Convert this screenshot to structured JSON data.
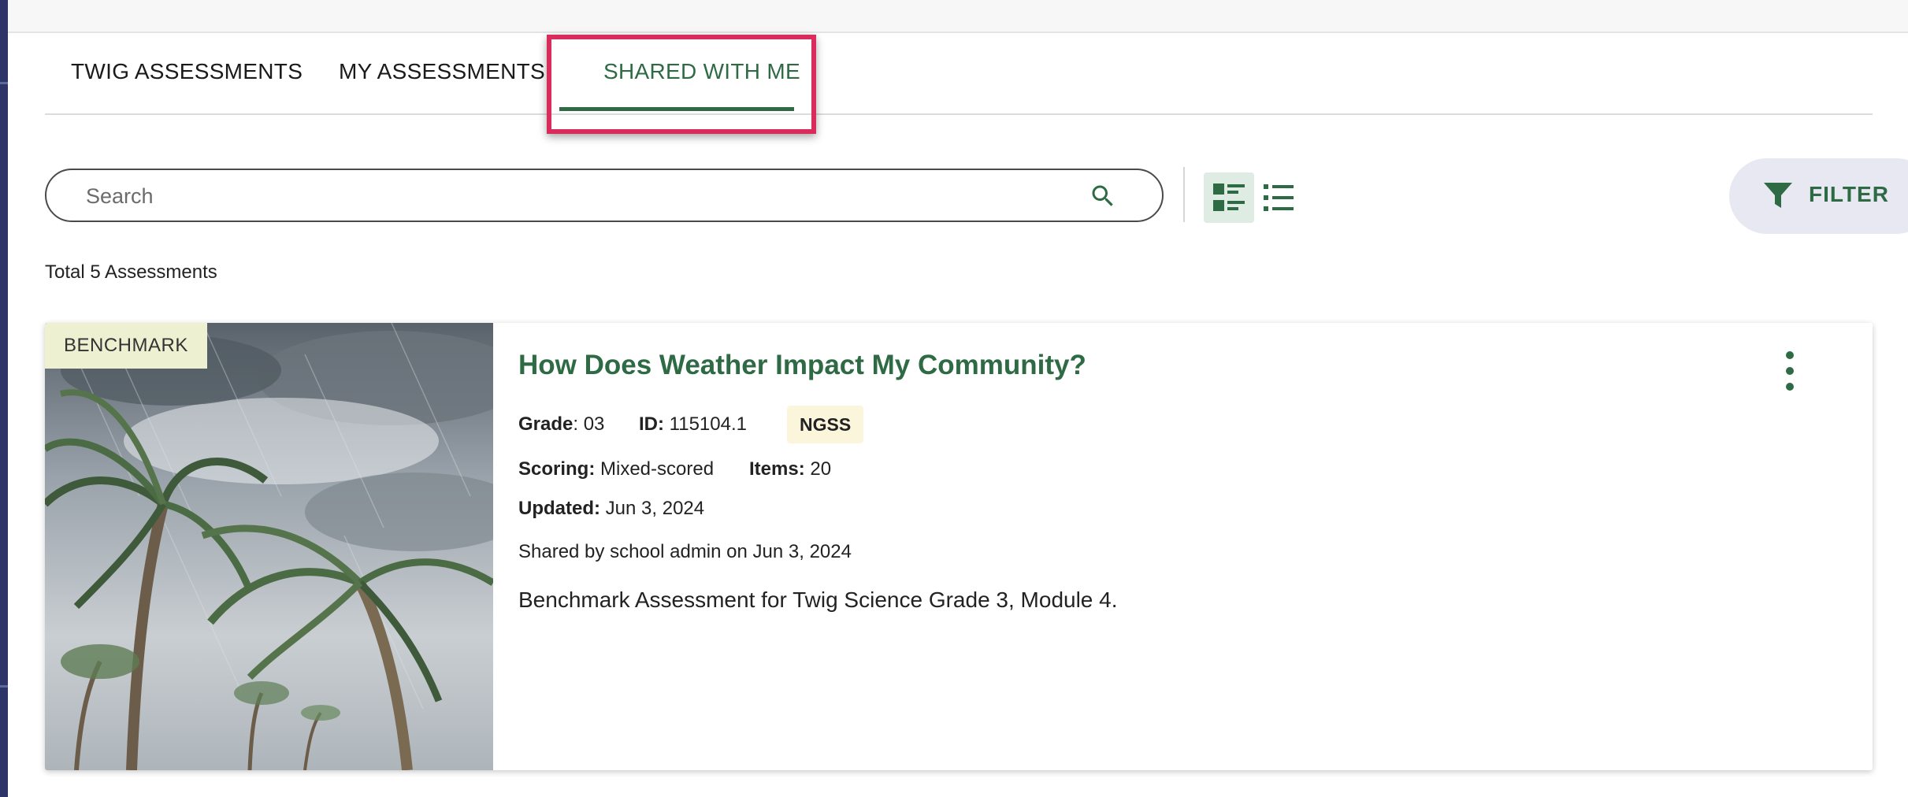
{
  "tabs": [
    {
      "label": "TWIG ASSESSMENTS"
    },
    {
      "label": "MY ASSESSMENTS"
    },
    {
      "label": "SHARED WITH ME"
    }
  ],
  "active_tab": "SHARED WITH ME",
  "search": {
    "placeholder": "Search"
  },
  "filter": {
    "label": "FILTER"
  },
  "total_label": "Total 5 Assessments",
  "colors": {
    "accent": "#2e6b45",
    "highlight": "#d92b5c"
  },
  "card": {
    "badge": "BENCHMARK",
    "title": "How Does Weather Impact My Community?",
    "grade_label": "Grade",
    "grade_value": ": 03",
    "id_label": "ID:",
    "id_value": " 115104.1",
    "standard": "NGSS",
    "scoring_label": "Scoring:",
    "scoring_value": " Mixed-scored",
    "items_label": "Items:",
    "items_value": " 20",
    "updated_label": "Updated:",
    "updated_value": " Jun 3, 2024",
    "shared": "Shared by school admin on Jun 3, 2024",
    "description": "Benchmark Assessment for Twig Science Grade 3, Module 4."
  }
}
